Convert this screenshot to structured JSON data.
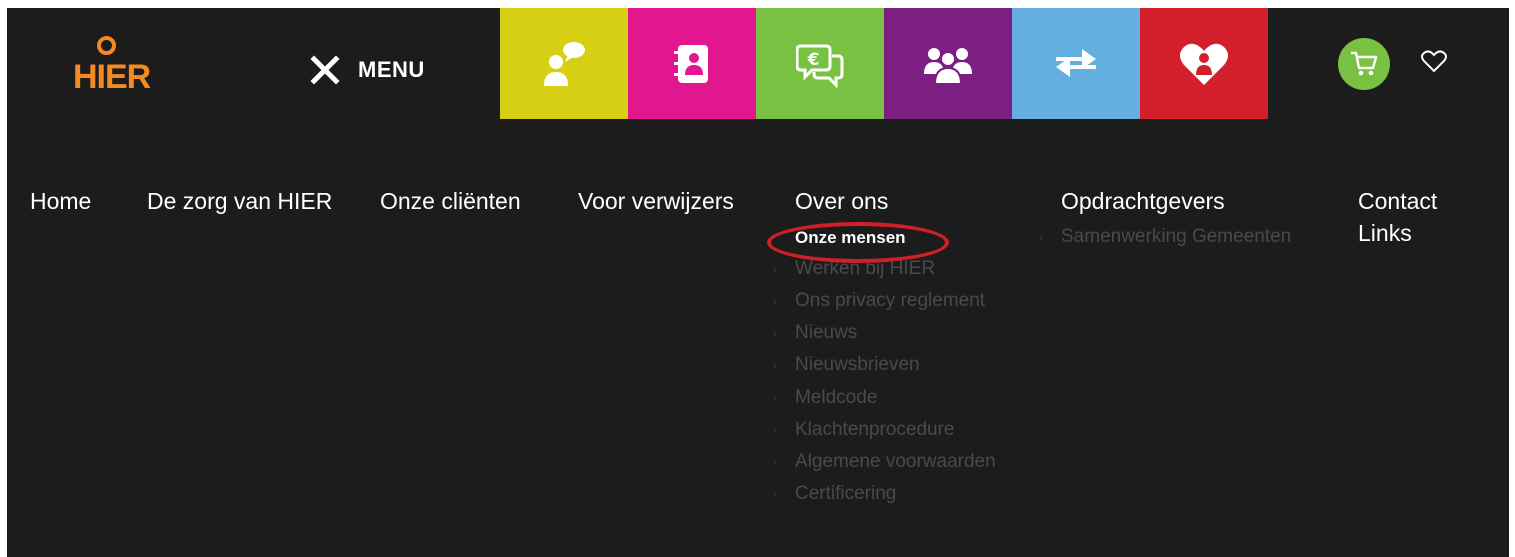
{
  "header": {
    "logo_text": "HIER",
    "menu_label": "MENU",
    "tiles": [
      {
        "name": "chat-tile",
        "color": "#d6cf14",
        "icon": "chat-person-icon"
      },
      {
        "name": "contacts-tile",
        "color": "#e2168e",
        "icon": "address-book-icon"
      },
      {
        "name": "costs-tile",
        "color": "#79c143",
        "icon": "euro-chat-icon"
      },
      {
        "name": "people-tile",
        "color": "#7d1e82",
        "icon": "group-icon"
      },
      {
        "name": "transfer-tile",
        "color": "#64aee0",
        "icon": "arrows-icon"
      },
      {
        "name": "care-tile",
        "color": "#d21f2b",
        "icon": "heart-person-icon"
      }
    ],
    "cart_color": "#79c143",
    "logo_color": "#f4891f",
    "background": "#1c1c1c"
  },
  "nav": {
    "items": [
      "Home",
      "De zorg van HIER",
      "Onze cliënten",
      "Voor verwijzers",
      "Over ons",
      "Opdrachtgevers",
      "Contact",
      "Links"
    ],
    "over_ons_sub": [
      "Onze mensen",
      "Werken bij HIER",
      "Ons privacy reglement",
      "Nieuws",
      "Nieuwsbrieven",
      "Meldcode",
      "Klachtenprocedure",
      "Algemene voorwaarden",
      "Certificering"
    ],
    "opdrachtgevers_sub": [
      "Samenwerking Gemeenten"
    ],
    "active_sub": "Onze mensen",
    "highlight_color": "#cf1f27"
  }
}
